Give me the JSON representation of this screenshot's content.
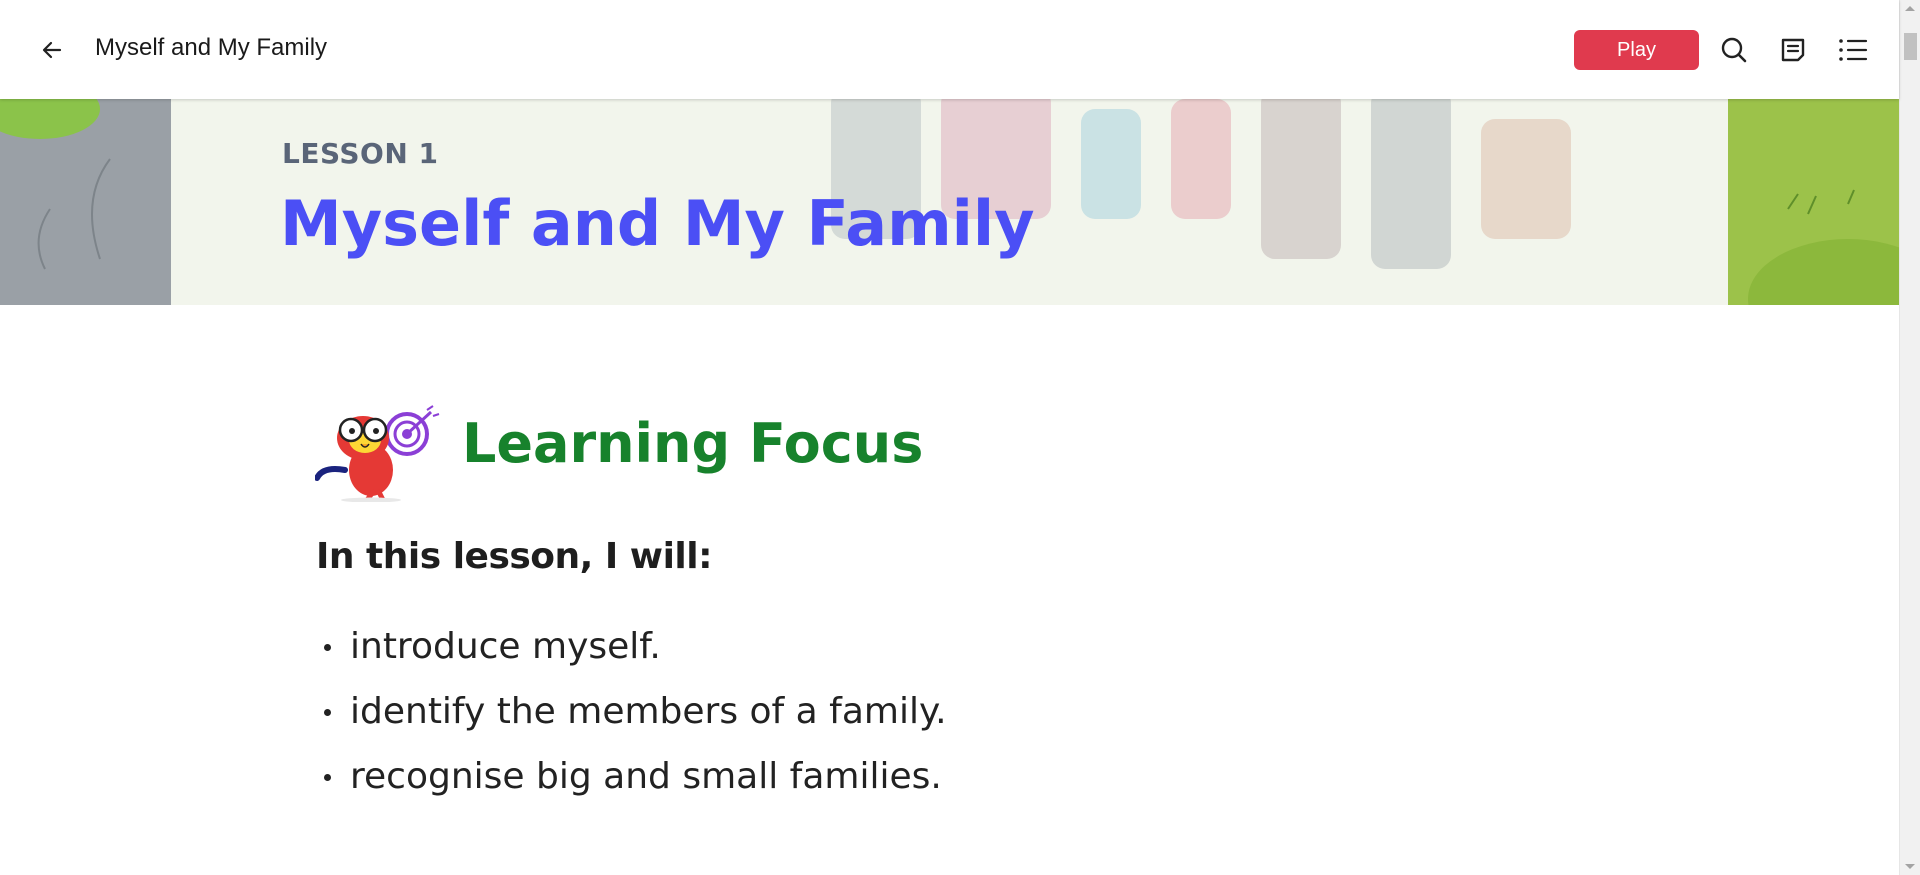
{
  "topbar": {
    "title": "Myself and My Family",
    "back_icon": "arrow-left-icon",
    "play_label": "Play",
    "search_icon": "search-icon",
    "notes_icon": "note-icon",
    "contents_icon": "list-icon",
    "accent_color": "#e03a4e"
  },
  "banner": {
    "lesson_label": "LESSON 1",
    "lesson_title": "Myself and My Family",
    "title_color": "#4b4ff5"
  },
  "learning_focus": {
    "heading": "Learning Focus",
    "heading_color": "#17822c",
    "mascot_icon": "parrot-with-target-icon",
    "intro": "In this lesson, I will:",
    "items": [
      {
        "text": "introduce myself."
      },
      {
        "text": "identify the members of a family."
      },
      {
        "text": "recognise big and small families."
      }
    ]
  }
}
